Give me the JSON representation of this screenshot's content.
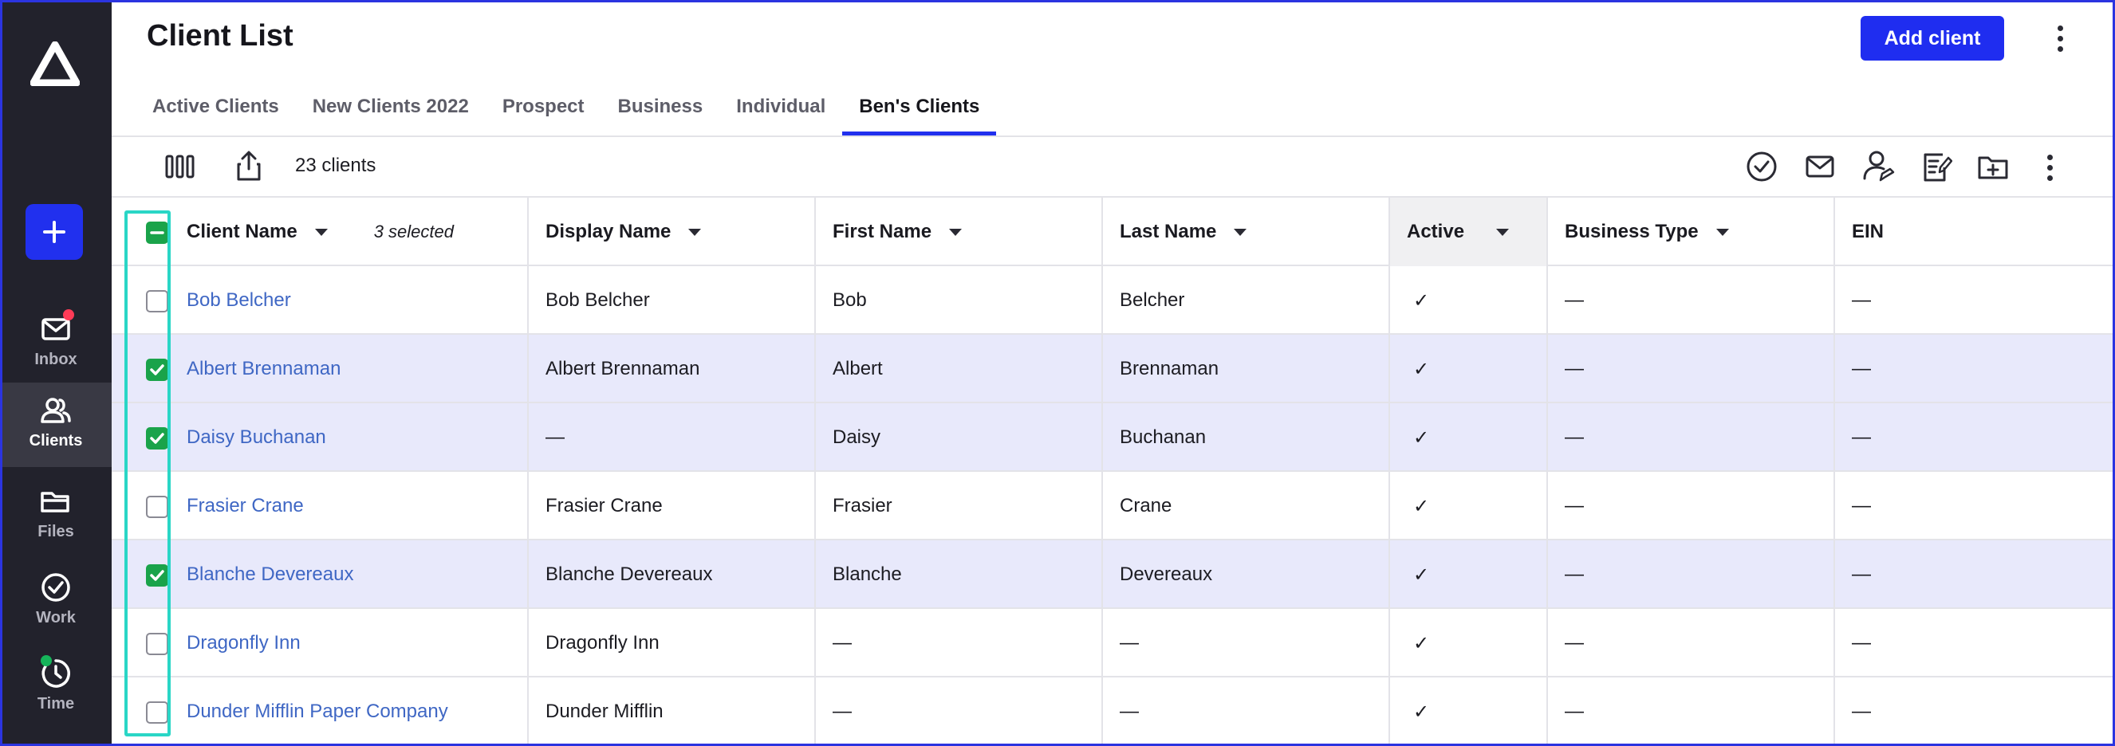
{
  "sidebar": {
    "nav": [
      {
        "label": "Inbox",
        "icon": "mail-icon",
        "badge_color": "#ff3b57"
      },
      {
        "label": "Clients",
        "icon": "clients-icon"
      },
      {
        "label": "Files",
        "icon": "folder-icon"
      },
      {
        "label": "Work",
        "icon": "check-circle-icon"
      },
      {
        "label": "Time",
        "icon": "timer-icon",
        "badge_color": "#16b45a"
      }
    ]
  },
  "header": {
    "title": "Client List",
    "add_button": "Add client"
  },
  "tabs": [
    {
      "label": "Active Clients",
      "active": false
    },
    {
      "label": "New Clients 2022",
      "active": false
    },
    {
      "label": "Prospect",
      "active": false
    },
    {
      "label": "Business",
      "active": false
    },
    {
      "label": "Individual",
      "active": false
    },
    {
      "label": "Ben's Clients",
      "active": true
    }
  ],
  "toolbar": {
    "count": "23 clients"
  },
  "table": {
    "selection_note": "3 selected",
    "columns": [
      "Client Name",
      "Display Name",
      "First Name",
      "Last Name",
      "Active",
      "Business Type",
      "EIN"
    ],
    "rows": [
      {
        "checked": false,
        "client_name": "Bob Belcher",
        "display_name": "Bob Belcher",
        "first_name": "Bob",
        "last_name": "Belcher",
        "active": "✓",
        "business_type": "—",
        "ein": "—"
      },
      {
        "checked": true,
        "client_name": "Albert Brennaman",
        "display_name": "Albert Brennaman",
        "first_name": "Albert",
        "last_name": "Brennaman",
        "active": "✓",
        "business_type": "—",
        "ein": "—"
      },
      {
        "checked": true,
        "client_name": "Daisy Buchanan",
        "display_name": "—",
        "first_name": "Daisy",
        "last_name": "Buchanan",
        "active": "✓",
        "business_type": "—",
        "ein": "—"
      },
      {
        "checked": false,
        "client_name": "Frasier Crane",
        "display_name": "Frasier Crane",
        "first_name": "Frasier",
        "last_name": "Crane",
        "active": "✓",
        "business_type": "—",
        "ein": "—"
      },
      {
        "checked": true,
        "client_name": "Blanche Devereaux",
        "display_name": "Blanche Devereaux",
        "first_name": "Blanche",
        "last_name": "Devereaux",
        "active": "✓",
        "business_type": "—",
        "ein": "—"
      },
      {
        "checked": false,
        "client_name": "Dragonfly Inn",
        "display_name": "Dragonfly Inn",
        "first_name": "—",
        "last_name": "—",
        "active": "✓",
        "business_type": "—",
        "ein": "—"
      },
      {
        "checked": false,
        "client_name": "Dunder Mifflin Paper Company",
        "display_name": "Dunder Mifflin",
        "first_name": "—",
        "last_name": "—",
        "active": "✓",
        "business_type": "—",
        "ein": "—"
      }
    ]
  },
  "colors": {
    "accent": "#2130ee",
    "sidebar": "#22222c",
    "checkbox_on": "#1aa34a",
    "highlight": "#2ad6c6",
    "link": "#3f67c4",
    "selected_row": "#e8e9fb"
  }
}
